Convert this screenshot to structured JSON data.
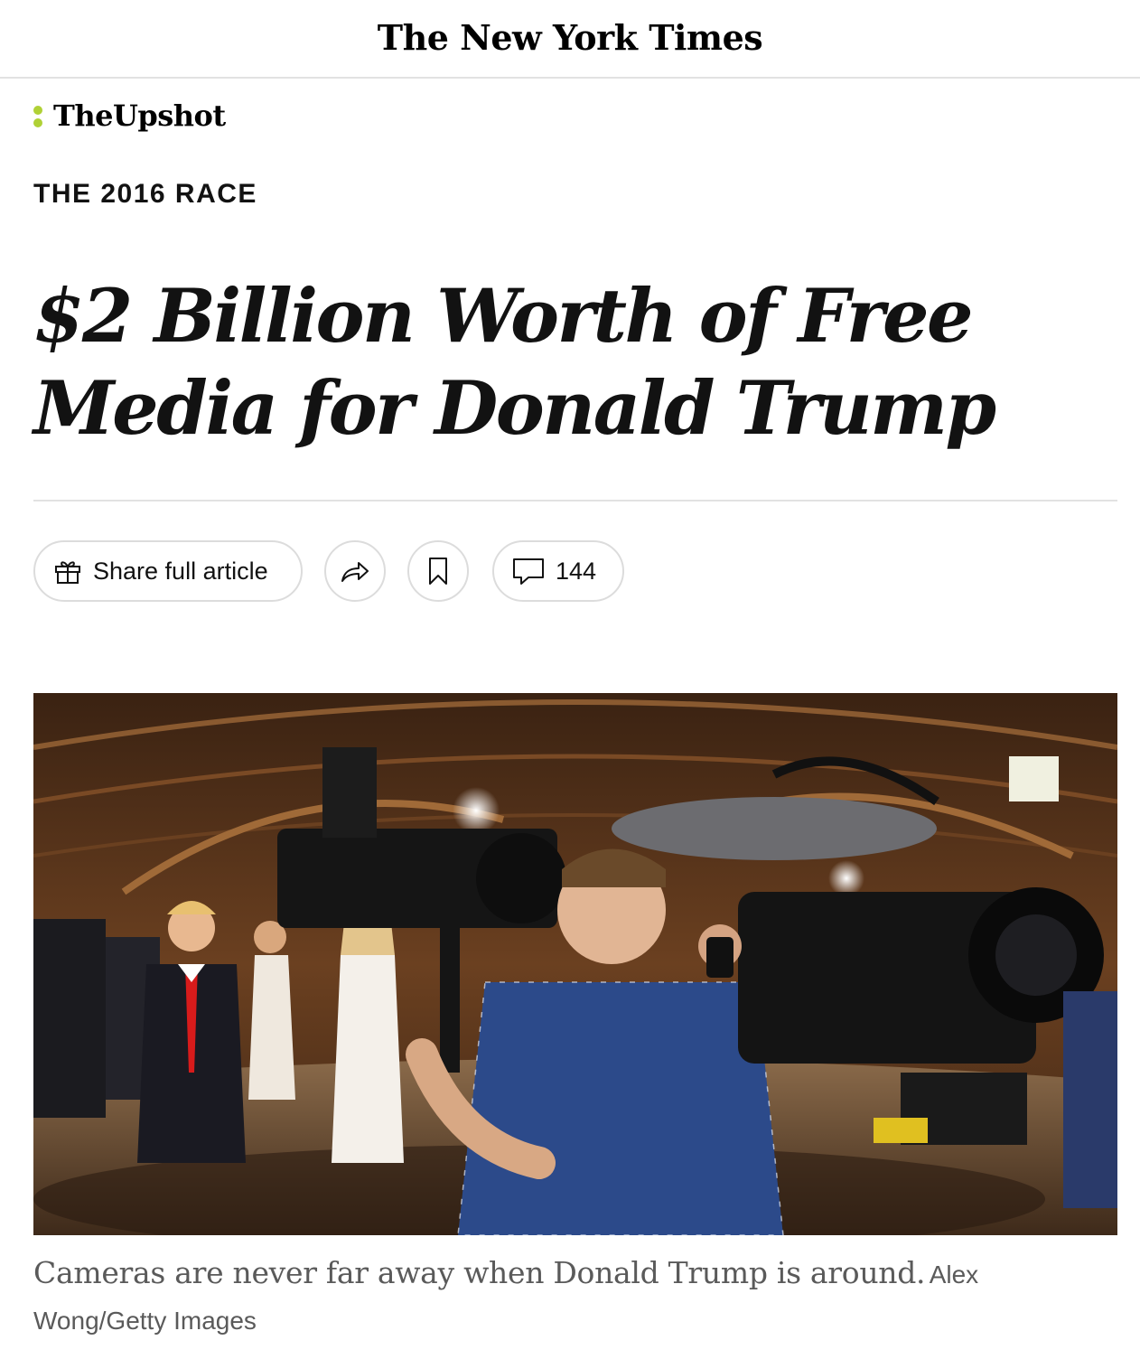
{
  "masthead": {
    "title": "The New York Times"
  },
  "section": {
    "name": "TheUpshot"
  },
  "article": {
    "kicker": "THE 2016 RACE",
    "headline": "$2 Billion Worth of Free Media for Donald Trump"
  },
  "actions": {
    "share_label": "Share full article",
    "comments_count": "144",
    "icons": [
      "gift-icon",
      "forward-arrow-icon",
      "bookmark-icon",
      "comment-bubble-icon"
    ]
  },
  "photo": {
    "caption": "Cameras are never far away when Donald Trump is around.",
    "credit": "Alex Wong/Getty Images"
  },
  "colors": {
    "upshot_accent": "#b0d136",
    "border": "#dcdcdc",
    "caption_gray": "#5a5a5a"
  }
}
